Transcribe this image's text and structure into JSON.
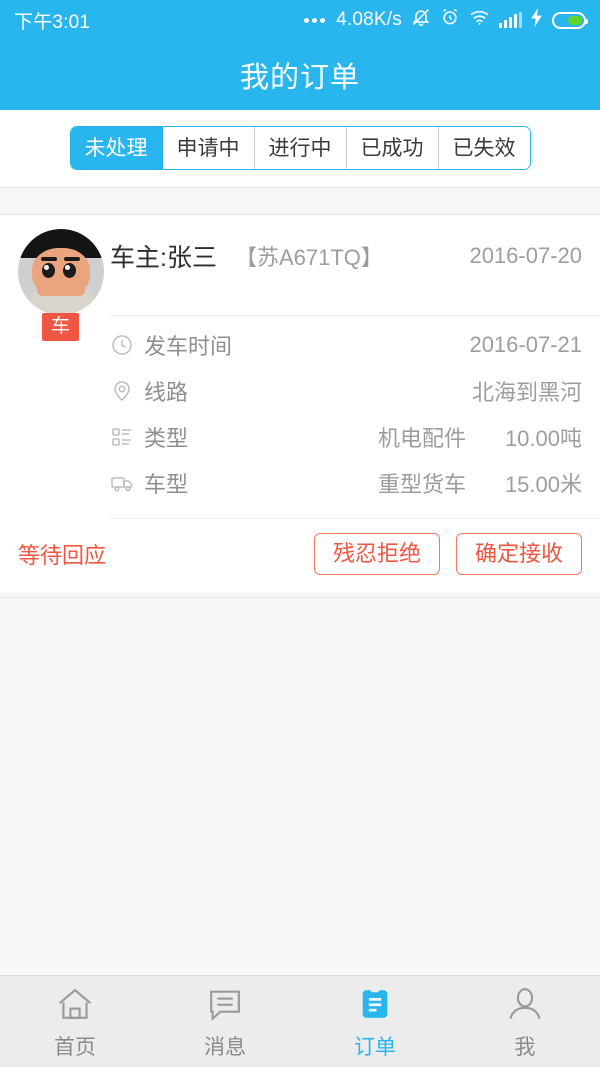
{
  "statusbar": {
    "time": "下午3:01",
    "network_speed": "4.08K/s",
    "icons": [
      "more-dots-icon",
      "bell-muted-icon",
      "alarm-clock-icon",
      "wifi-icon",
      "signal-bars-icon",
      "charging-bolt-icon",
      "battery-icon"
    ]
  },
  "header": {
    "title": "我的订单"
  },
  "tabs": [
    {
      "label": "未处理",
      "active": true
    },
    {
      "label": "申请中",
      "active": false
    },
    {
      "label": "进行中",
      "active": false
    },
    {
      "label": "已成功",
      "active": false
    },
    {
      "label": "已失效",
      "active": false
    }
  ],
  "order": {
    "avatar_badge": "车",
    "owner": "车主:张三",
    "plate": "【苏A671TQ】",
    "created_date": "2016-07-20",
    "rows": [
      {
        "icon": "clock-icon",
        "label": "发车时间",
        "value1": "",
        "value2": "2016-07-21"
      },
      {
        "icon": "location-pin-icon",
        "label": "线路",
        "value1": "",
        "value2": "北海到黑河"
      },
      {
        "icon": "category-list-icon",
        "label": "类型",
        "value1": "机电配件",
        "value2": "10.00吨"
      },
      {
        "icon": "truck-icon",
        "label": "车型",
        "value1": "重型货车",
        "value2": "15.00米"
      }
    ],
    "status_text": "等待回应",
    "reject_label": "残忍拒绝",
    "accept_label": "确定接收"
  },
  "bottom_nav": [
    {
      "label": "首页",
      "icon": "home-icon",
      "active": false
    },
    {
      "label": "消息",
      "icon": "message-icon",
      "active": false
    },
    {
      "label": "订单",
      "icon": "clipboard-icon",
      "active": true
    },
    {
      "label": "我",
      "icon": "person-icon",
      "active": false
    }
  ],
  "colors": {
    "brand_blue": "#29b6ef",
    "accent_red": "#f15642",
    "battery_green": "#5fd52a"
  }
}
